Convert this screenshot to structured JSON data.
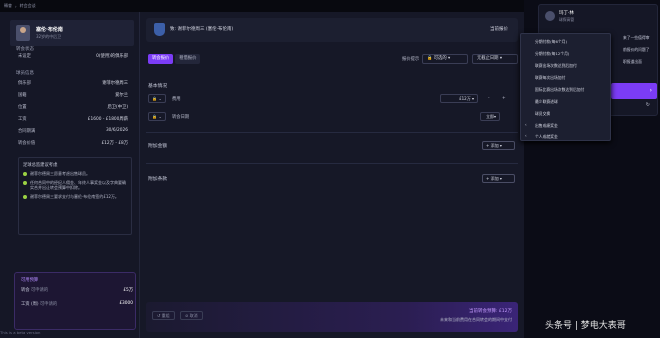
{
  "topbar": {
    "home": "轉會",
    "nav": "转会会谈"
  },
  "sidebar": {
    "player_name": "塞伦·布伦南",
    "player_sub": "32岁的中后卫",
    "transfer_status_title": "转会状态",
    "transfer_status": "未设定",
    "transfer_status_value": "0(使用)的俱乐部",
    "player_info_title": "球员信息",
    "rows": [
      {
        "label": "俱乐部",
        "value": "谢菲尔德周三"
      },
      {
        "label": "国籍",
        "value": "爱尔兰"
      },
      {
        "label": "位置",
        "value": "后卫(中卫)"
      },
      {
        "label": "工资",
        "value": "£1600 - £1800周薪"
      },
      {
        "label": "合同期满",
        "value": "30/6/2026"
      },
      {
        "label": "转会价值",
        "value": "£12万 - £8万"
      }
    ],
    "advice_title": "足球总监建议考虑",
    "advice": [
      "谢菲尔德周三愿意考虑出售球员。",
      "任何合同中的经纪人佣金、年终人事奖金以及字典要确实合并出让转会预算中扣除。",
      "谢菲尔德周三要求支付与塞伦·布伦南签约£12万。"
    ],
    "budget_title": "可用预算",
    "budget": [
      {
        "label": "转会",
        "sub": "可申请的",
        "value": "£5万"
      },
      {
        "label": "工资 (周)",
        "sub": "可申请的",
        "value": "£3000"
      }
    ],
    "beta": "This is a beta version"
  },
  "main": {
    "club_title": "致: 谢菲尔德周三 (塞伦·布伦南)",
    "current_offer": "当前报价",
    "tab_transfer": "转会报价",
    "tab_loan": "租借报价",
    "notify_label": "报价提示",
    "ctrl_offer": "可选的",
    "ctrl_deadline": "无截止日期",
    "basic_title": "基本情况",
    "fee_label": "费用",
    "fee_value": "£12万",
    "date_label": "转会日期",
    "date_value": "立即",
    "add_fee_title": "附加金额",
    "add_clause_title": "附加条款",
    "add_btn": "添加",
    "footer_total": "当前转会预算: £12万",
    "footer_sub": "未来和当前费用在合同转会的期间中支付",
    "btn_reset": "重组",
    "btn_cancel": "取消"
  },
  "menu": {
    "items": [
      "分期付款(每6个月)",
      "分期付款(每12个月)",
      "联赛出场次数达到后加付",
      "联赛每次出场加付",
      "国际比赛出场次数达到后加付",
      "最少联赛进球",
      "球员交换",
      "出售成绩奖金",
      "个人成就奖金"
    ]
  },
  "chat": {
    "name": "玛丁·林",
    "sub": "球探高管",
    "line1": "来了一些值得审",
    "line2": "前报价的问题了",
    "line3": "职报道出面"
  },
  "watermark": "头条号 | 梦电大表哥"
}
